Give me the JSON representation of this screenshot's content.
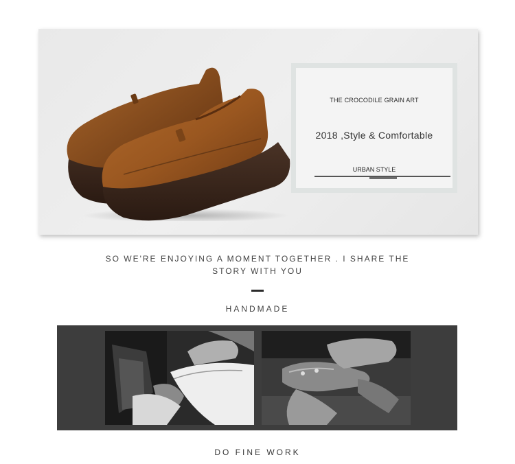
{
  "hero": {
    "shoe_image": "brown-leather-platform-loafers",
    "card": {
      "kicker": "THE CROCODILE GRAIN ART",
      "title": "2018 ,Style & Comfortable",
      "style_label": "URBAN STYLE"
    }
  },
  "story": {
    "tagline": "SO WE'RE ENJOYING A MOMENT TOGETHER . I SHARE THE STORY WITH YOU",
    "section_label": "HANDMADE"
  },
  "gallery": {
    "photos": [
      "craftsman-shaping-white-leather",
      "craftsman-hammering-shoe-last"
    ]
  },
  "footer": {
    "label": "DO FINE WORK"
  }
}
